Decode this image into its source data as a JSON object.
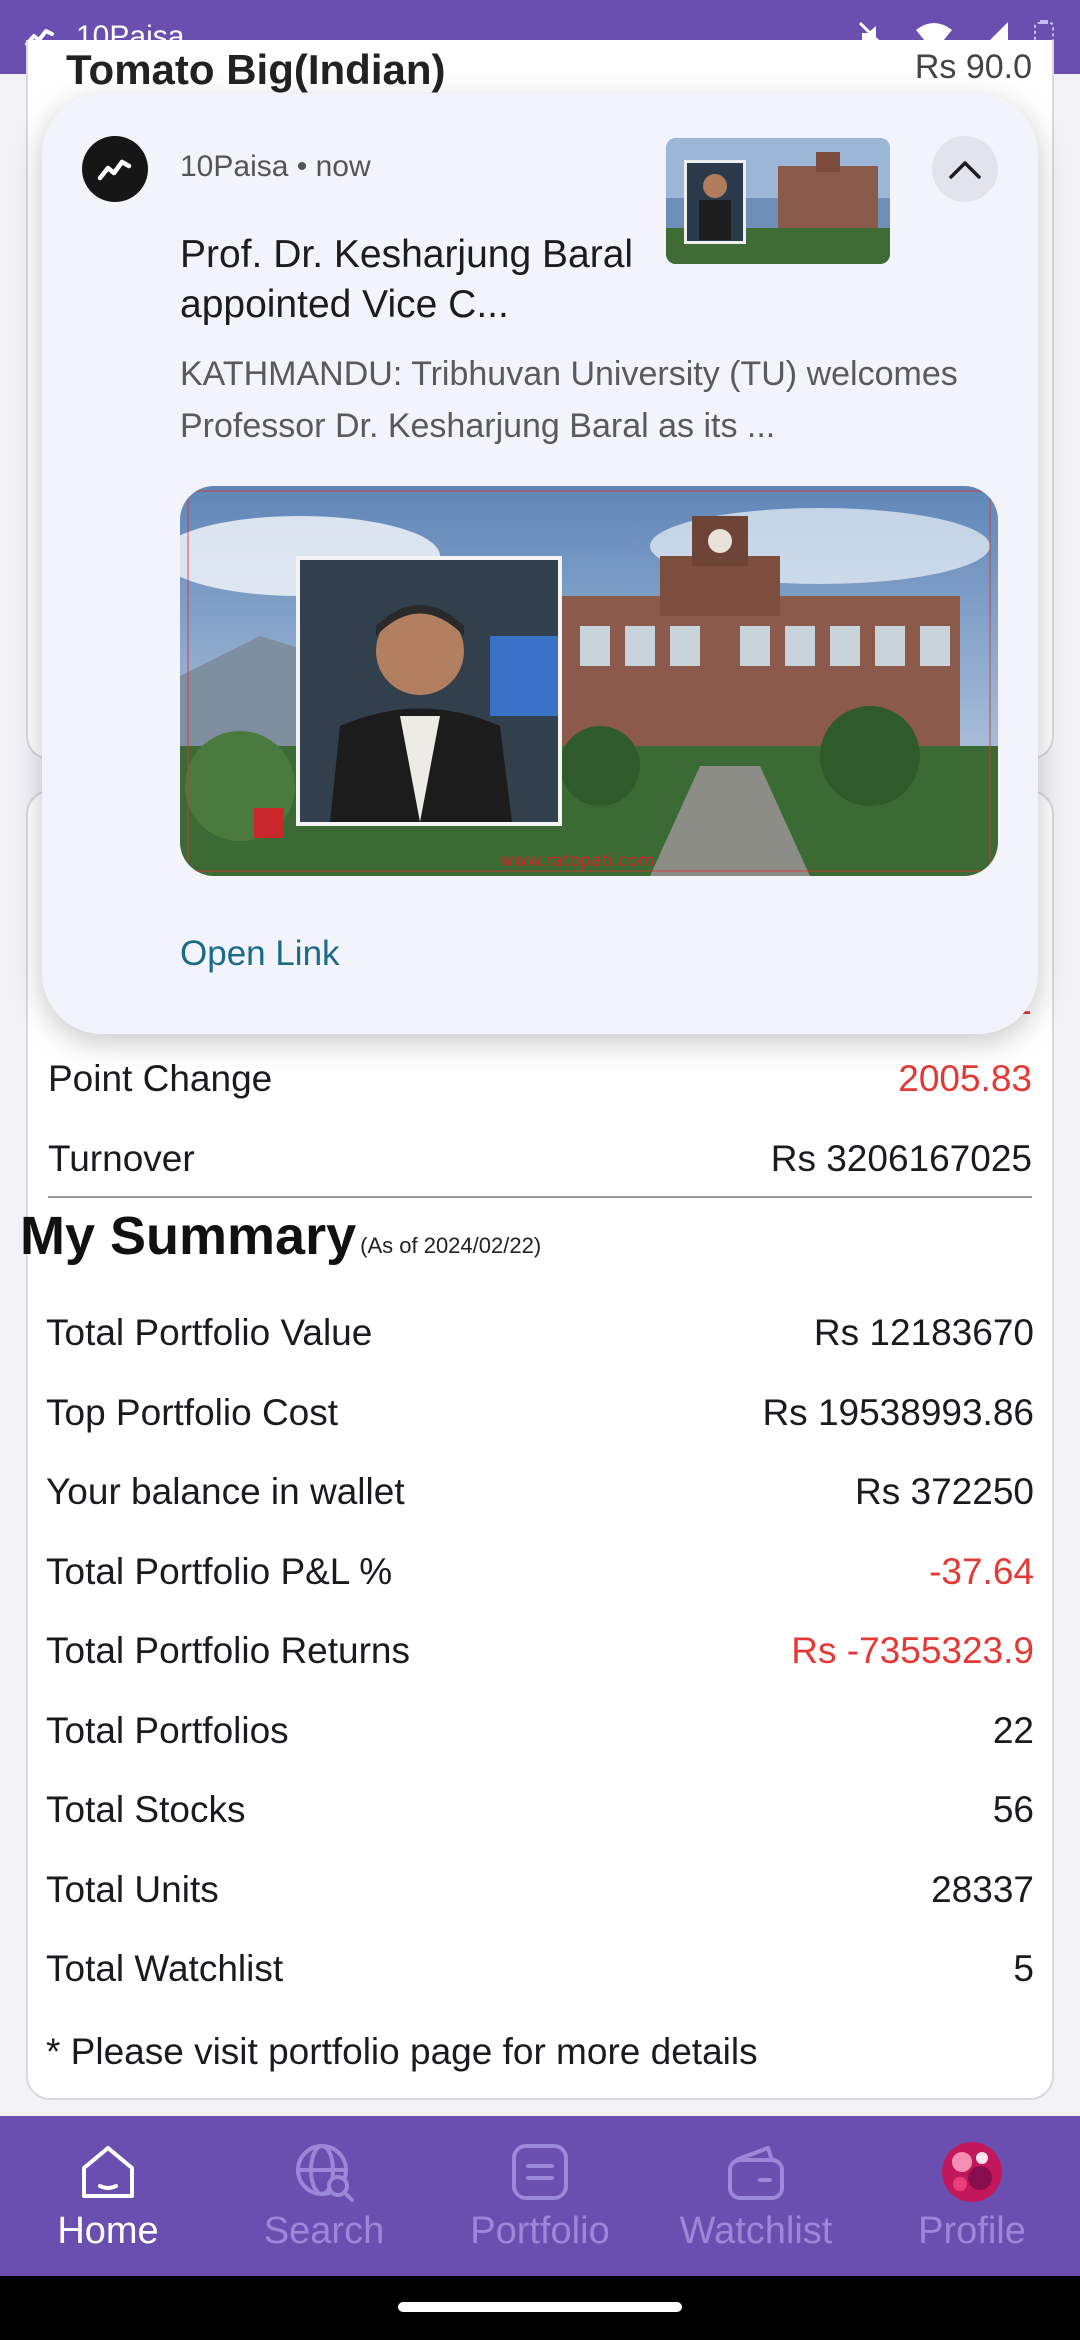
{
  "status_bar": {
    "app_name": "10Paisa"
  },
  "background_card": {
    "item_title": "Tomato Big(Indian)",
    "item_price": "Rs 90.0"
  },
  "market": {
    "partial_row_value": "2",
    "point_change_label": "Point Change",
    "point_change_value": "2005.83",
    "turnover_label": "Turnover",
    "turnover_value": "Rs 3206167025"
  },
  "summary": {
    "title": "My Summary",
    "as_of": "(As of 2024/02/22)",
    "rows": [
      {
        "label": "Total Portfolio Value",
        "value": "Rs 12183670",
        "negative": false
      },
      {
        "label": "Top Portfolio Cost",
        "value": "Rs 19538993.86",
        "negative": false
      },
      {
        "label": "Your balance in wallet",
        "value": "Rs 372250",
        "negative": false
      },
      {
        "label": "Total Portfolio P&L %",
        "value": "-37.64",
        "negative": true
      },
      {
        "label": "Total Portfolio Returns",
        "value": "Rs -7355323.9",
        "negative": true
      },
      {
        "label": "Total Portfolios",
        "value": "22",
        "negative": false
      },
      {
        "label": "Total Stocks",
        "value": "56",
        "negative": false
      },
      {
        "label": "Total Units",
        "value": "28337",
        "negative": false
      },
      {
        "label": "Total Watchlist",
        "value": "5",
        "negative": false
      }
    ],
    "footnote": "* Please visit portfolio page for more details"
  },
  "notification": {
    "app": "10Paisa",
    "time": "now",
    "meta": "10Paisa • now",
    "title": "Prof. Dr. Kesharjung Baral appointed Vice C...",
    "body": "KATHMANDU: Tribhuvan University (TU) welcomes Professor Dr. Kesharjung Baral as its ...",
    "image_watermark": "www.ratopati.com",
    "action": "Open Link"
  },
  "bottom_nav": {
    "items": [
      {
        "label": "Home",
        "icon": "home-icon",
        "active": true
      },
      {
        "label": "Search",
        "icon": "search-globe-icon",
        "active": false
      },
      {
        "label": "Portfolio",
        "icon": "portfolio-icon",
        "active": false
      },
      {
        "label": "Watchlist",
        "icon": "wallet-icon",
        "active": false
      },
      {
        "label": "Profile",
        "icon": "avatar-icon",
        "active": false
      }
    ]
  },
  "colors": {
    "brand": "#6a4fb0",
    "negative": "#e53935",
    "link": "#1a6b8a"
  }
}
